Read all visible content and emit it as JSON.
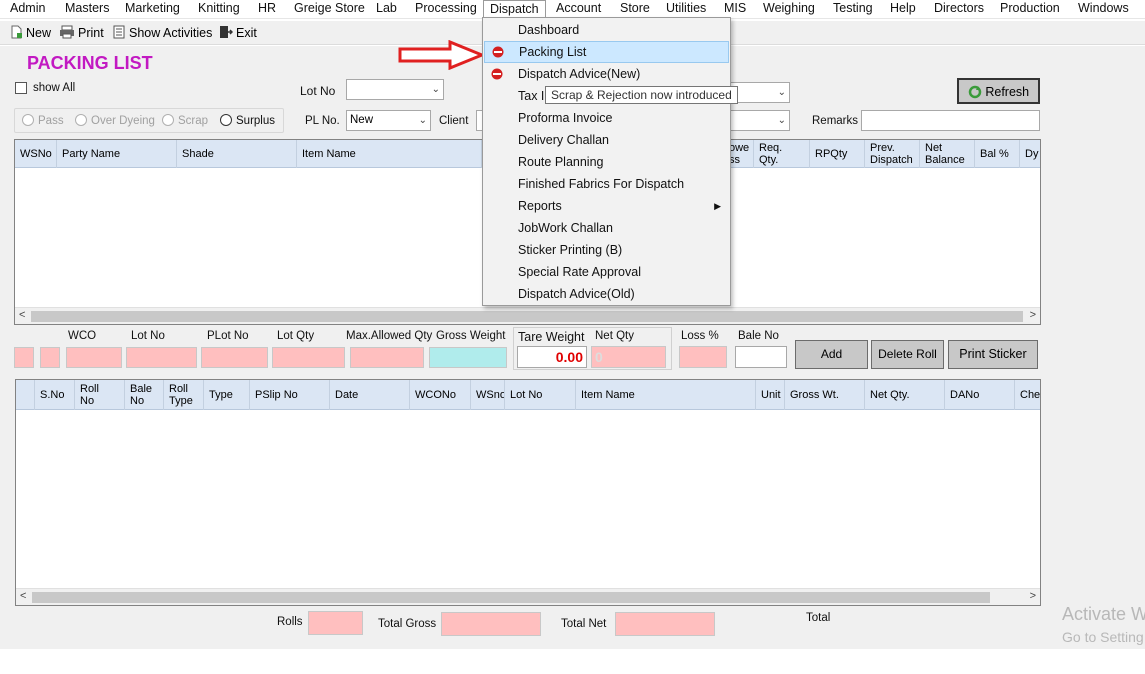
{
  "menu": {
    "items": [
      "Admin",
      "Masters",
      "Marketing",
      "Knitting",
      "HR",
      "Greige Store",
      "Lab",
      "Processing",
      "Dispatch",
      "Account",
      "Store",
      "Utilities",
      "MIS",
      "Weighing",
      "Testing",
      "Help",
      "Directors",
      "Production",
      "Windows"
    ],
    "active": "Dispatch"
  },
  "toolbar": {
    "new": "New",
    "print": "Print",
    "show_activities": "Show Activities",
    "exit": "Exit"
  },
  "form": {
    "title": "PACKING LIST",
    "show_all": "show All",
    "lot_no_label": "Lot No",
    "pl_no_label": "PL No.",
    "pl_no_value": "New",
    "client_label": "Client",
    "remarks_label": "Remarks",
    "refresh": "Refresh",
    "radios": [
      "Pass",
      "Over Dyeing",
      "Scrap",
      "Surplus"
    ],
    "selected_radio": "Surplus"
  },
  "top_grid": {
    "headers_left": [
      "WSNo",
      "Party Name",
      "Shade",
      "Item Name"
    ],
    "headers_right": [
      "owe\nss",
      "Req.\nQty.",
      "RPQty",
      "Prev.\nDispatch",
      "Net\nBalance",
      "Bal %",
      "Dy"
    ]
  },
  "entry": {
    "labels": [
      "WCO",
      "Lot No",
      "PLot No",
      "Lot Qty",
      "Max.Allowed Qty",
      "Gross Weight",
      "Tare Weight",
      "Net Qty",
      "Loss %",
      "Bale No"
    ],
    "tare_weight": "0.00",
    "net_qty": "0",
    "add": "Add",
    "delete_roll": "Delete Roll",
    "print_sticker": "Print Sticker"
  },
  "bottom_grid": {
    "headers": [
      "S.No",
      "Roll\nNo",
      "Bale\nNo",
      "Roll\nType",
      "Type",
      "PSlip No",
      "Date",
      "WCONo",
      "WSno",
      "Lot No",
      "Item Name",
      "Unit",
      "Gross Wt.",
      "Net Qty.",
      "DANo",
      "Chec"
    ]
  },
  "totals": {
    "rolls": "Rolls",
    "total_gross": "Total Gross",
    "total_net": "Total Net",
    "total": "Total"
  },
  "dispatch_menu": {
    "items": [
      "Dashboard",
      "Packing List",
      "Dispatch Advice(New)",
      "Tax In",
      "Proforma Invoice",
      "Delivery Challan",
      "Route Planning",
      "Finished Fabrics For Dispatch",
      "Reports",
      "JobWork Challan",
      "Sticker Printing (B)",
      "Special Rate Approval",
      "Dispatch Advice(Old)"
    ],
    "highlighted": "Packing List"
  },
  "tooltip": "Scrap & Rejection now introduced",
  "watermark": {
    "line1": "Activate W",
    "line2": "Go to Setting"
  },
  "colors": {
    "title": "#c219c2",
    "pink_field": "#ffbfbf",
    "cyan_field": "#b0ecec",
    "arrow": "#e02020",
    "menu_highlight": "#cce8ff",
    "grid_header": "#dbe6f4"
  }
}
